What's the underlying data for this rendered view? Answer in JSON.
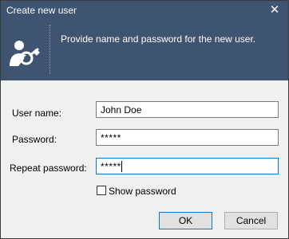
{
  "window": {
    "title": "Create new user",
    "close_glyph": "✕"
  },
  "banner": {
    "icon": "user-with-key-icon",
    "text": "Provide name and password for the new user."
  },
  "form": {
    "username_label": "User name:",
    "username_value": "John Doe",
    "password_label": "Password:",
    "password_value": "*****",
    "repeat_label": "Repeat password:",
    "repeat_value": "*****",
    "show_password_label": "Show password",
    "show_password_checked": false
  },
  "buttons": {
    "ok": "OK",
    "cancel": "Cancel"
  },
  "colors": {
    "banner_bg": "#3f5471",
    "focus_border": "#0078d7",
    "window_bg": "#f0f0f0"
  }
}
